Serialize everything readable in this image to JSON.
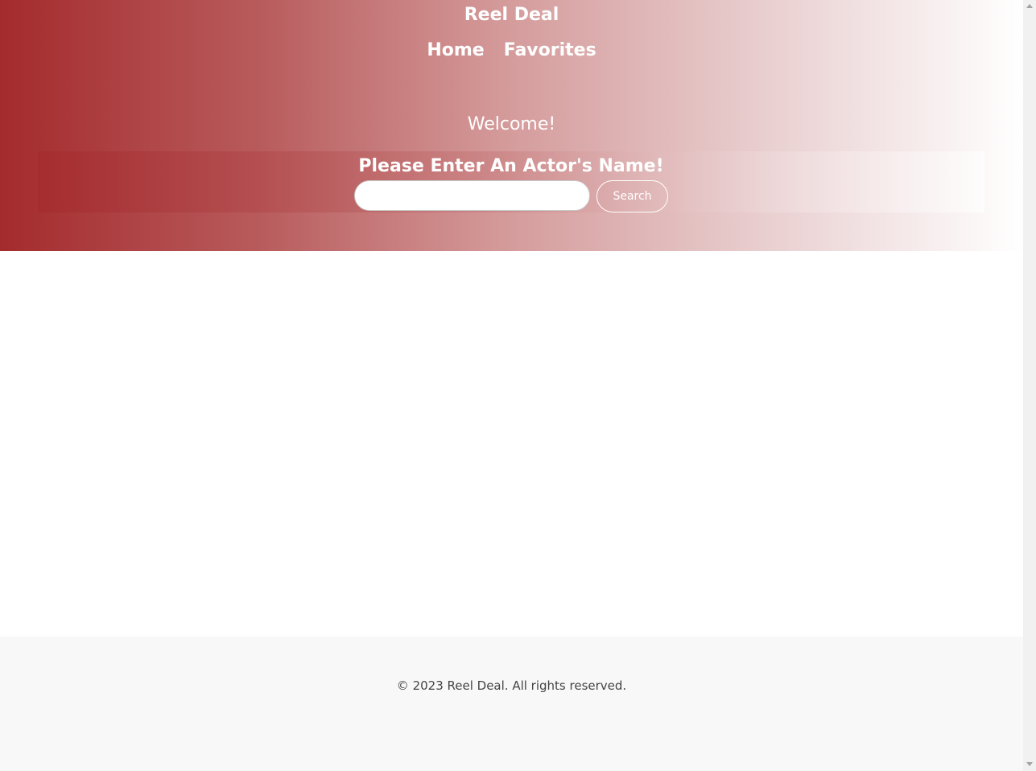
{
  "header": {
    "site_title": "Reel Deal",
    "nav": [
      {
        "label": "Home"
      },
      {
        "label": "Favorites"
      }
    ]
  },
  "hero": {
    "welcome": "Welcome!"
  },
  "search": {
    "heading": "Please Enter An Actor's Name!",
    "input_value": "",
    "input_placeholder": "",
    "button_label": "Search"
  },
  "footer": {
    "copyright": "© 2023 Reel Deal. All rights reserved."
  },
  "colors": {
    "gradient_start": "#a42b2d",
    "gradient_end": "#ffffff",
    "header_text": "#ffffff",
    "footer_bg": "#f8f8f8",
    "footer_text": "#444444"
  },
  "icons": {
    "scroll_up": "scroll-up-arrow-icon",
    "scroll_down": "scroll-down-arrow-icon"
  }
}
